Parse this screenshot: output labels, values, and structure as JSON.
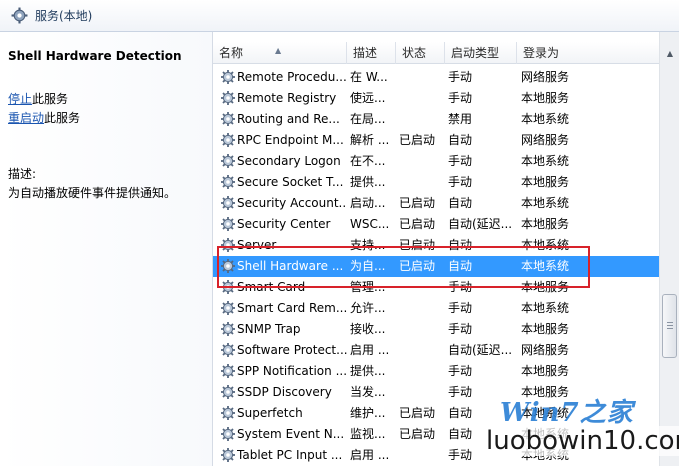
{
  "window": {
    "title": "服务(本地)"
  },
  "left_pane": {
    "service_title": "Shell Hardware Detection",
    "actions": [
      {
        "link": "停止",
        "suffix": "此服务"
      },
      {
        "link": "重启动",
        "suffix": "此服务"
      }
    ],
    "desc_label": "描述:",
    "desc_text": "为自动播放硬件事件提供通知。"
  },
  "table": {
    "columns": [
      "名称",
      "描述",
      "状态",
      "启动类型",
      "登录为"
    ],
    "rows": [
      {
        "name": "Remote Procedu...",
        "desc": "在 W...",
        "state": "",
        "start": "手动",
        "logon": "网络服务"
      },
      {
        "name": "Remote Registry",
        "desc": "使远...",
        "state": "",
        "start": "手动",
        "logon": "本地服务"
      },
      {
        "name": "Routing and Re...",
        "desc": "在局...",
        "state": "",
        "start": "禁用",
        "logon": "本地系统"
      },
      {
        "name": "RPC Endpoint M...",
        "desc": "解析 ...",
        "state": "已启动",
        "start": "自动",
        "logon": "网络服务"
      },
      {
        "name": "Secondary Logon",
        "desc": "在不...",
        "state": "",
        "start": "手动",
        "logon": "本地系统"
      },
      {
        "name": "Secure Socket T...",
        "desc": "提供...",
        "state": "",
        "start": "手动",
        "logon": "本地服务"
      },
      {
        "name": "Security Account...",
        "desc": "启动...",
        "state": "已启动",
        "start": "自动",
        "logon": "本地系统"
      },
      {
        "name": "Security Center",
        "desc": "WSC...",
        "state": "已启动",
        "start": "自动(延迟...",
        "logon": "本地服务"
      },
      {
        "name": "Server",
        "desc": "支持...",
        "state": "已启动",
        "start": "自动",
        "logon": "本地系统"
      },
      {
        "name": "Shell Hardware ...",
        "desc": "为自...",
        "state": "已启动",
        "start": "自动",
        "logon": "本地系统",
        "selected": true
      },
      {
        "name": "Smart Card",
        "desc": "管理...",
        "state": "",
        "start": "手动",
        "logon": "本地服务"
      },
      {
        "name": "Smart Card Rem...",
        "desc": "允许...",
        "state": "",
        "start": "手动",
        "logon": "本地系统"
      },
      {
        "name": "SNMP Trap",
        "desc": "接收...",
        "state": "",
        "start": "手动",
        "logon": "本地服务"
      },
      {
        "name": "Software Protect...",
        "desc": "启用 ...",
        "state": "",
        "start": "自动(延迟...",
        "logon": "网络服务"
      },
      {
        "name": "SPP Notification ...",
        "desc": "提供...",
        "state": "",
        "start": "手动",
        "logon": "本地服务"
      },
      {
        "name": "SSDP Discovery",
        "desc": "当发...",
        "state": "",
        "start": "手动",
        "logon": "本地服务"
      },
      {
        "name": "Superfetch",
        "desc": "维护...",
        "state": "已启动",
        "start": "自动",
        "logon": "本地系统"
      },
      {
        "name": "System Event N...",
        "desc": "监视...",
        "state": "已启动",
        "start": "自动",
        "logon": "本地系统"
      },
      {
        "name": "Tablet PC Input ...",
        "desc": "启用 ...",
        "state": "",
        "start": "手动",
        "logon": "本地系统"
      }
    ]
  },
  "watermark": {
    "top": "Win7之家",
    "bottom": "luobowin10.com"
  },
  "colors": {
    "selection": "#3399ff",
    "highlight_box": "#d8222a",
    "link": "#1a55b0"
  },
  "icons": {
    "title": "gear-icon",
    "service": "service-gear-icon"
  }
}
